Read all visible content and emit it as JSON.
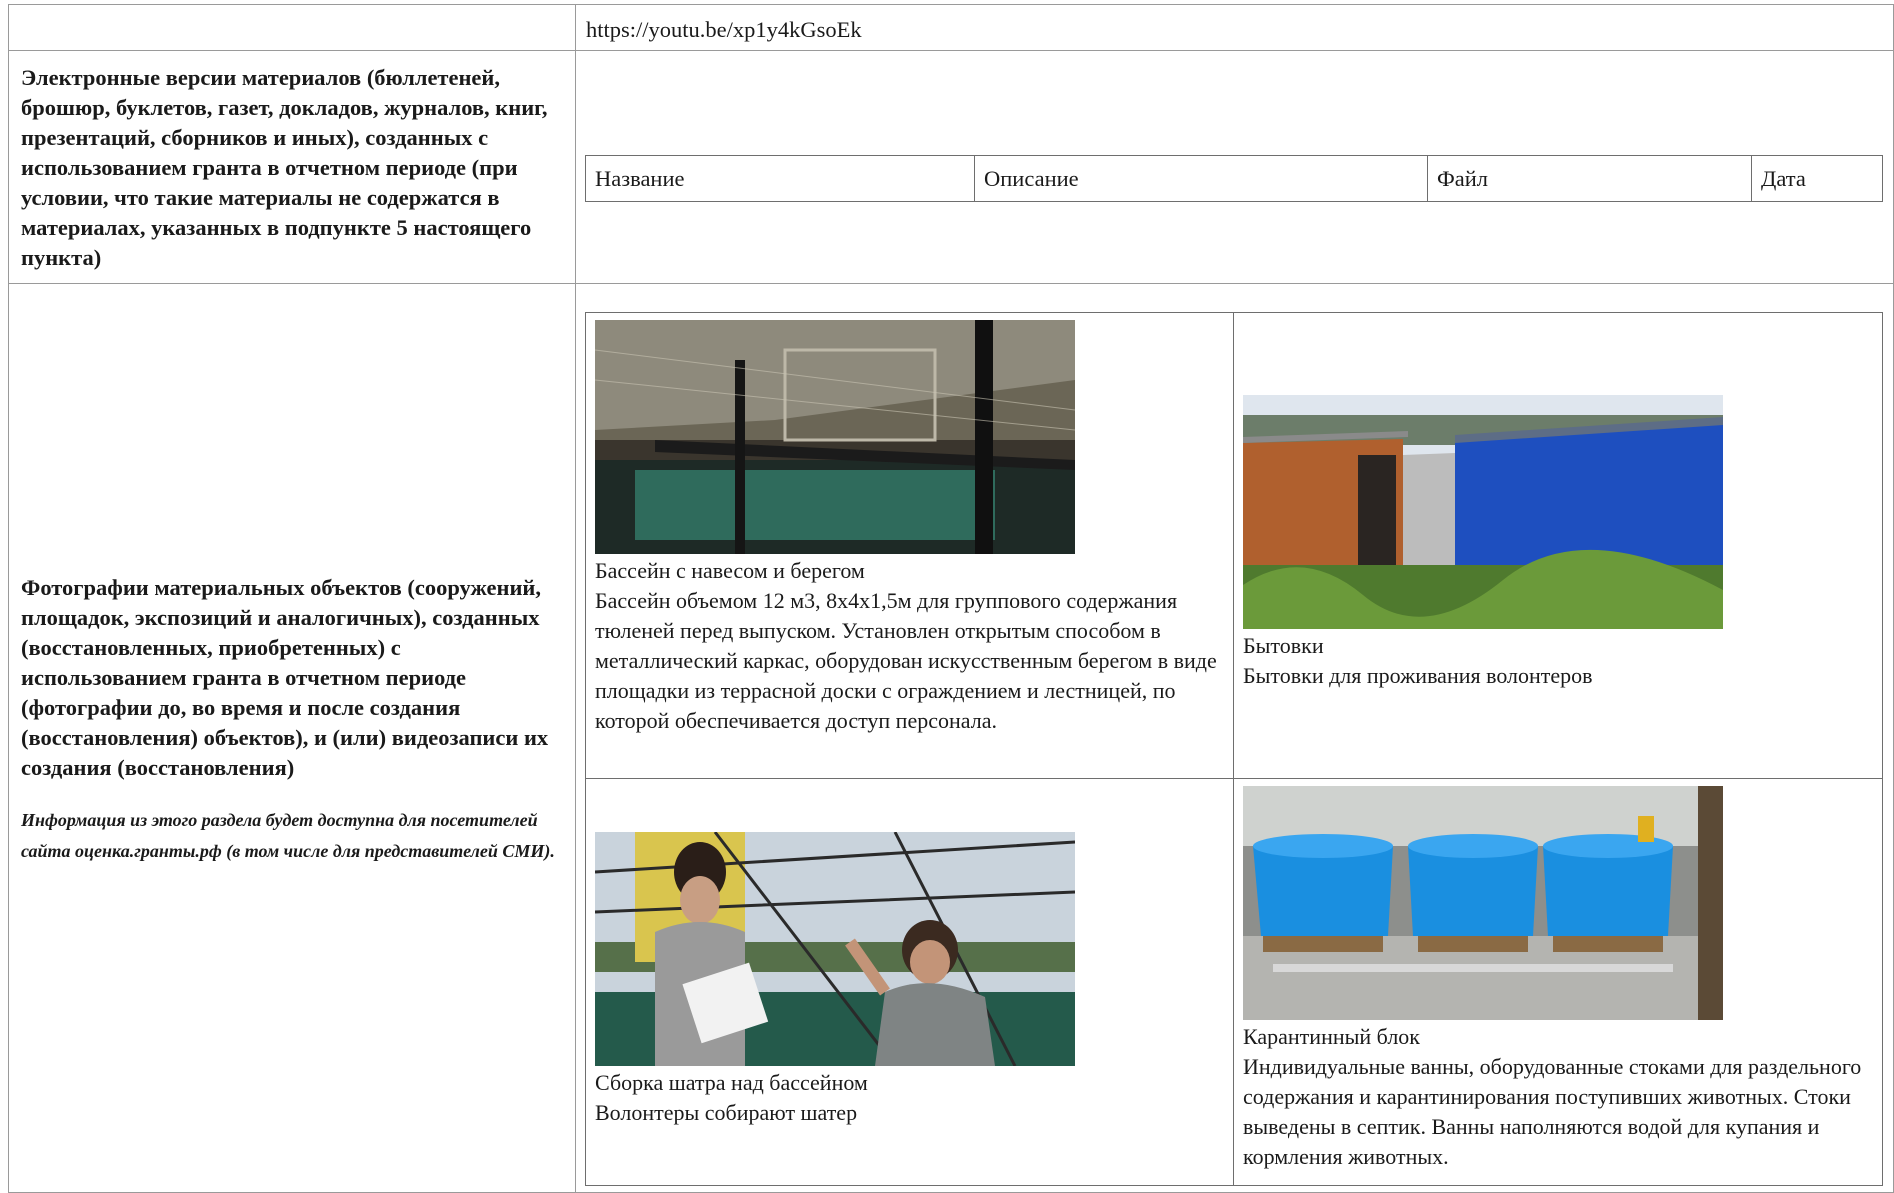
{
  "rows": [
    {
      "label": "",
      "value": "https://youtu.be/xp1y4kGsoEk"
    },
    {
      "label": "Электронные версии материалов (бюллетеней, брошюр, буклетов, газет, докладов, журналов, книг, презентаций, сборников и иных), созданных с использованием гранта в отчетном периоде (при условии, что такие материалы не содержатся в материалах, указанных в подпункте 5 настоящего пункта)",
      "columns": [
        "Название",
        "Описание",
        "Файл",
        "Дата"
      ]
    },
    {
      "label": "Фотографии материальных объектов (сооружений, площадок, экспозиций и аналогичных), созданных (восстановленных, приобретенных) с использованием гранта в отчетном периоде (фотографии до, во время и после создания (восстановления) объектов), и (или) видеозаписи их создания (восстановления)",
      "note": "Информация из этого раздела будет доступна для посетителей сайта оценка.гранты.рф (в том числе для представителей СМИ)."
    }
  ],
  "photos": [
    {
      "image": "pool-with-canopy-photo",
      "title": "Бассейн с навесом и берегом",
      "description": "Бассейн объемом 12 м3, 8х4х1,5м для группового содержания тюленей перед выпуском. Установлен открытым способом в металлический каркас, оборудован искусственным берегом в виде площадки из террасной доски с ограждением и лестницей, по которой обеспечивается доступ персонала."
    },
    {
      "image": "cabins-photo",
      "title": "Бытовки",
      "description": "Бытовки для проживания волонтеров"
    },
    {
      "image": "tent-assembly-photo",
      "title": "Сборка шатра над бассейном",
      "description": "Волонтеры собирают шатер"
    },
    {
      "image": "quarantine-tubs-photo",
      "title": "Карантинный блок",
      "description": "Индивидуальные ванны, оборудованные стоками для раздельного содержания и карантинирования поступивших животных. Стоки выведены в септик. Ванны наполняются водой для купания и кормления животных."
    }
  ],
  "colors": {
    "border": "#9a9a9a",
    "text": "#1a1a1a",
    "background": "#ffffff"
  }
}
